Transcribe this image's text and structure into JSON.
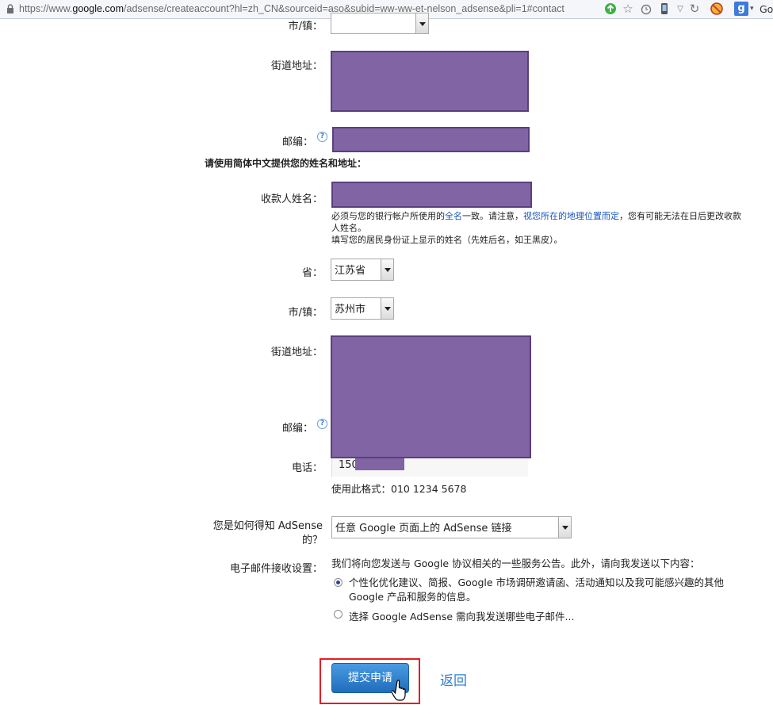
{
  "browser": {
    "url_prefix": "https://www.",
    "url_domain": "google.com",
    "url_path": "/adsense/createaccount?hl=zh_CN&sourceid=aso&subid=ww-ww-et-nelson_adsense&pli=1#contact",
    "search_engine_short": "Goo"
  },
  "form1": {
    "city_label_partial": "市/镇：",
    "street_label": "街道地址：",
    "postal_label": "邮编：",
    "section_note": "请使用简体中文提供您的姓名和地址："
  },
  "payee": {
    "label": "收款人姓名：",
    "note_part1": "必须与您的银行帐户所使用的",
    "note_link1": "全名",
    "note_part2": "一致。请注意，",
    "note_link2": "视您所在的地理位置而定",
    "note_part3": "，您有可能无法在日后更改收款人姓名。",
    "note_line2": "填写您的居民身份证上显示的姓名（先姓后名，如王黑皮）。"
  },
  "province": {
    "label": "省：",
    "value": "江苏省"
  },
  "city": {
    "label": "市/镇：",
    "value": "苏州市"
  },
  "street2": {
    "label": "街道地址："
  },
  "postal2": {
    "label": "邮编："
  },
  "phone": {
    "label": "电话：",
    "value": "150",
    "format_hint": "使用此格式：010 1234 5678"
  },
  "referral": {
    "label_line1": "您是如何得知 AdSense",
    "label_line2": "的？",
    "value": "任意 Google 页面上的 AdSense 链接"
  },
  "email": {
    "label": "电子邮件接收设置：",
    "intro": "我们将向您发送与 Google 协议相关的一些服务公告。此外，请向我发送以下内容：",
    "option1_line1": "个性化优化建议、简报、Google 市场调研邀请函、活动通知以及我可能感兴趣的其他",
    "option1_line2": "Google 产品和服务的信息。",
    "option2": "选择 Google AdSense 需向我发送哪些电子邮件..."
  },
  "actions": {
    "submit": "提交申请",
    "back": "返回"
  },
  "colors": {
    "redaction": "#8164a3",
    "highlight": "#e31e24",
    "button": "#2f7fd3"
  }
}
